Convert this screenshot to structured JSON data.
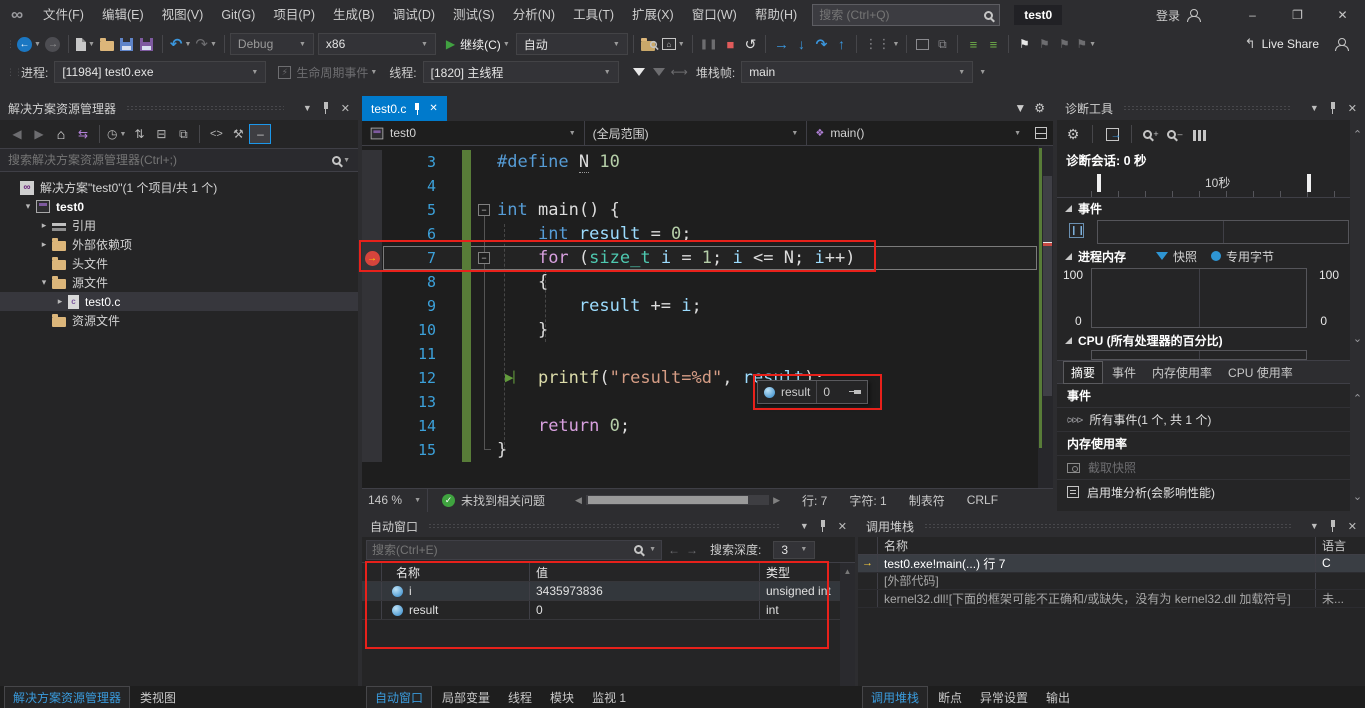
{
  "title_bar": {
    "menus": [
      "文件(F)",
      "编辑(E)",
      "视图(V)",
      "Git(G)",
      "项目(P)",
      "生成(B)",
      "调试(D)",
      "测试(S)",
      "分析(N)",
      "工具(T)",
      "扩展(X)",
      "窗口(W)",
      "帮助(H)"
    ],
    "search_placeholder": "搜索 (Ctrl+Q)",
    "project_chip": "test0",
    "sign_in": "登录"
  },
  "toolbar": {
    "config": "Debug",
    "platform": "x86",
    "continue_label": "继续(C)",
    "attach_mode": "自动",
    "live_share": "Live Share"
  },
  "debug_bar": {
    "process_label": "进程:",
    "process_value": "[11984] test0.exe",
    "lifecycle_label": "生命周期事件",
    "thread_label": "线程:",
    "thread_value": "[1820] 主线程",
    "frame_label": "堆栈帧:",
    "frame_value": "main"
  },
  "solution_explorer": {
    "title": "解决方案资源管理器",
    "search_placeholder": "搜索解决方案资源管理器(Ctrl+;)",
    "tree": [
      {
        "label": "解决方案\"test0\"(1 个项目/共 1 个)"
      },
      {
        "label": "test0"
      },
      {
        "label": "引用"
      },
      {
        "label": "外部依赖项"
      },
      {
        "label": "头文件"
      },
      {
        "label": "源文件"
      },
      {
        "label": "test0.c"
      },
      {
        "label": "资源文件"
      }
    ],
    "tabs": [
      "解决方案资源管理器",
      "类视图"
    ]
  },
  "editor": {
    "tab_label": "test0.c",
    "nav_project": "test0",
    "nav_scope": "(全局范围)",
    "nav_member": "main()",
    "lines": [
      {
        "n": "3",
        "segs": [
          {
            "t": "#define "
          },
          {
            "t": "N"
          },
          {
            "t": " 10"
          }
        ]
      },
      {
        "n": "4",
        "segs": []
      },
      {
        "n": "5",
        "segs": [
          {
            "t": "int "
          },
          {
            "t": "main() {"
          }
        ]
      },
      {
        "n": "6",
        "segs": [
          {
            "t": "    "
          },
          {
            "t": "int "
          },
          {
            "t": "result"
          },
          {
            "t": " = "
          },
          {
            "t": "0"
          },
          {
            "t": ";"
          }
        ]
      },
      {
        "n": "7",
        "segs": [
          {
            "t": "    "
          },
          {
            "t": "for "
          },
          {
            "t": "("
          },
          {
            "t": "size_t"
          },
          {
            "t": " "
          },
          {
            "t": "i"
          },
          {
            "t": " = "
          },
          {
            "t": "1"
          },
          {
            "t": "; "
          },
          {
            "t": "i"
          },
          {
            "t": " <= "
          },
          {
            "t": "N"
          },
          {
            "t": "; "
          },
          {
            "t": "i"
          },
          {
            "t": "++)"
          }
        ]
      },
      {
        "n": "8",
        "segs": [
          {
            "t": "    {"
          }
        ]
      },
      {
        "n": "9",
        "segs": [
          {
            "t": "        "
          },
          {
            "t": "result"
          },
          {
            "t": " += "
          },
          {
            "t": "i"
          },
          {
            "t": ";"
          }
        ]
      },
      {
        "n": "10",
        "segs": [
          {
            "t": "    }"
          }
        ]
      },
      {
        "n": "11",
        "segs": []
      },
      {
        "n": "12",
        "segs": [
          {
            "t": "    "
          },
          {
            "t": "printf"
          },
          {
            "t": "("
          },
          {
            "t": "\"result=%d\""
          },
          {
            "t": ", "
          },
          {
            "t": "result"
          },
          {
            "t": ");"
          }
        ]
      },
      {
        "n": "13",
        "segs": []
      },
      {
        "n": "14",
        "segs": [
          {
            "t": "    "
          },
          {
            "t": "return "
          },
          {
            "t": "0"
          },
          {
            "t": ";"
          }
        ]
      },
      {
        "n": "15",
        "segs": [
          {
            "t": "}"
          }
        ]
      }
    ],
    "data_tip": {
      "name": "result",
      "value": "0"
    },
    "status": {
      "zoom": "146 %",
      "health": "未找到相关问题",
      "line": "行: 7",
      "column": "字符: 1",
      "tabs": "制表符",
      "eol": "CRLF"
    }
  },
  "autos": {
    "title": "自动窗口",
    "search_placeholder": "搜索(Ctrl+E)",
    "depth_label": "搜索深度:",
    "depth_value": "3",
    "columns": [
      "名称",
      "值",
      "类型"
    ],
    "rows": [
      {
        "name": "i",
        "value": "3435973836",
        "type": "unsigned int"
      },
      {
        "name": "result",
        "value": "0",
        "type": "int"
      }
    ],
    "tabs": [
      "自动窗口",
      "局部变量",
      "线程",
      "模块",
      "监视 1"
    ]
  },
  "diagnostics": {
    "title": "诊断工具",
    "session": "诊断会话: 0 秒",
    "timeline_label": "10秒",
    "events_section": "事件",
    "memory_section": "进程内存",
    "legend_snapshot": "快照",
    "legend_private_bytes": "专用字节",
    "mem_top": "100",
    "mem_bottom": "0",
    "cpu_section": "CPU (所有处理器的百分比)",
    "tabs": [
      "摘要",
      "事件",
      "内存使用率",
      "CPU 使用率"
    ],
    "summary": {
      "events_heading": "事件",
      "all_events": "所有事件(1 个, 共 1 个)",
      "memory_heading": "内存使用率",
      "take_snapshot": "截取快照",
      "heap_profiling": "启用堆分析(会影响性能)"
    }
  },
  "call_stack": {
    "title": "调用堆栈",
    "columns": [
      "名称",
      "语言"
    ],
    "rows": [
      {
        "name": "test0.exe!main(...) 行 7",
        "lang": "C"
      },
      {
        "name": "[外部代码]",
        "lang": ""
      },
      {
        "name": "kernel32.dll![下面的框架可能不正确和/或缺失，没有为 kernel32.dll 加载符号]",
        "lang": "未..."
      }
    ],
    "tabs": [
      "调用堆栈",
      "断点",
      "异常设置",
      "输出"
    ]
  },
  "colors": {
    "accent": "#007acc",
    "annotation_red": "#e8211b",
    "keyword": "#569cd6",
    "control_keyword": "#d8a0df",
    "type": "#4ec9b0",
    "variable": "#9cdcfe",
    "number": "#b5cea8",
    "string": "#d69d85",
    "function": "#dcdcaa"
  }
}
